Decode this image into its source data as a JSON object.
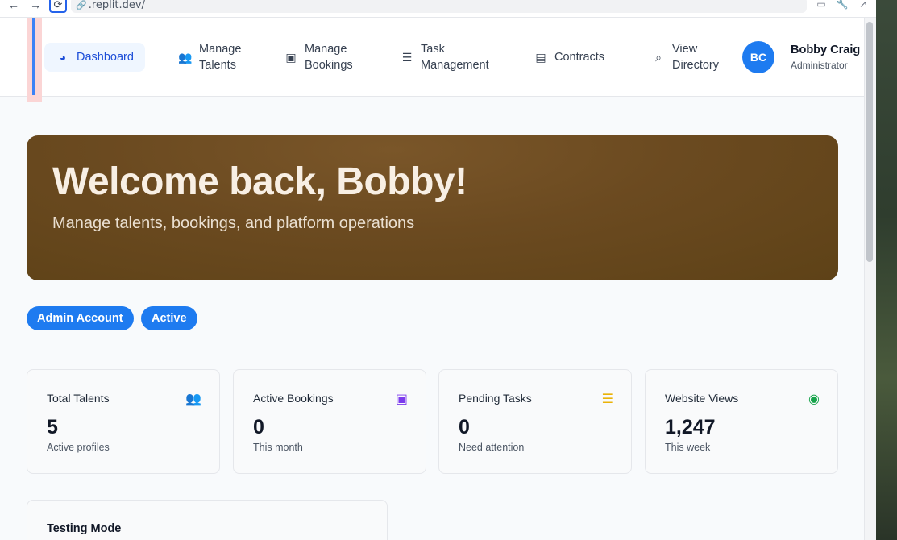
{
  "browser": {
    "url": ".replit.dev/"
  },
  "nav": {
    "items": [
      {
        "label": "Dashboard",
        "icon": "dashboard-gauge-icon"
      },
      {
        "label": "Manage\nTalents",
        "icon": "users-icon"
      },
      {
        "label": "Manage\nBookings",
        "icon": "calendar-icon"
      },
      {
        "label": "Task\nManagement",
        "icon": "task-list-icon"
      },
      {
        "label": "Contracts",
        "icon": "document-icon"
      },
      {
        "label": "View\nDirectory",
        "icon": "search-icon"
      }
    ],
    "active_index": 0
  },
  "user": {
    "initials": "BC",
    "name": "Bobby Craig",
    "role": "Administrator"
  },
  "hero": {
    "title": "Welcome back, Bobby!",
    "subtitle": "Manage talents, bookings, and platform operations"
  },
  "badges": [
    "Admin Account",
    "Active"
  ],
  "stats": [
    {
      "title": "Total Talents",
      "value": "5",
      "sub": "Active profiles",
      "icon": "users-icon",
      "color": "#2563eb"
    },
    {
      "title": "Active Bookings",
      "value": "0",
      "sub": "This month",
      "icon": "calendar-check-icon",
      "color": "#7c3aed"
    },
    {
      "title": "Pending Tasks",
      "value": "0",
      "sub": "Need attention",
      "icon": "task-list-icon",
      "color": "#eab308"
    },
    {
      "title": "Website Views",
      "value": "1,247",
      "sub": "This week",
      "icon": "eye-icon",
      "color": "#16a34a"
    }
  ],
  "testing": {
    "title": "Testing Mode"
  }
}
